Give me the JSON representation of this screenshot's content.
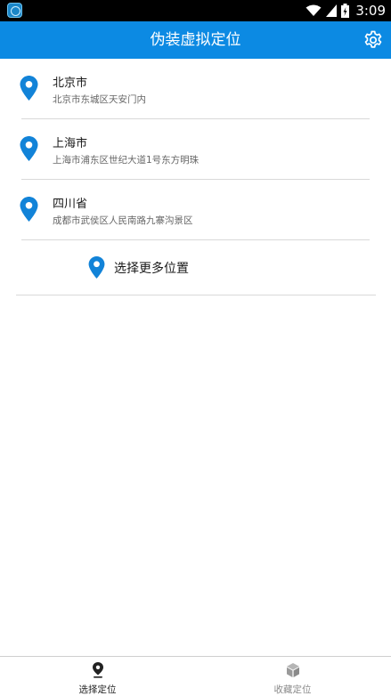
{
  "status_bar": {
    "time": "3:09"
  },
  "app_bar": {
    "title": "伪装虚拟定位"
  },
  "locations": [
    {
      "name": "北京市",
      "address": "北京市东城区天安门内"
    },
    {
      "name": "上海市",
      "address": "上海市浦东区世纪大道1号东方明珠"
    },
    {
      "name": "四川省",
      "address": "成都市武侯区人民南路九寨沟景区"
    }
  ],
  "more_locations": {
    "label": "选择更多位置"
  },
  "bottom_nav": {
    "tabs": [
      {
        "label": "选择定位",
        "active": true
      },
      {
        "label": "收藏定位",
        "active": false
      }
    ]
  },
  "colors": {
    "primary": "#0c8ae3",
    "pin": "#1283d8",
    "text": "#1a1a1a",
    "subtext": "#666666",
    "divider": "#d9d9d9",
    "nav_inactive": "#8a8a8a"
  },
  "icons": {
    "app": "app-icon",
    "wifi": "wifi-icon",
    "signal": "signal-icon",
    "battery": "battery-icon",
    "settings": "gear-icon",
    "location_pin": "location-pin-icon",
    "tab_select": "location-pin-icon",
    "tab_favorites": "cube-icon"
  }
}
